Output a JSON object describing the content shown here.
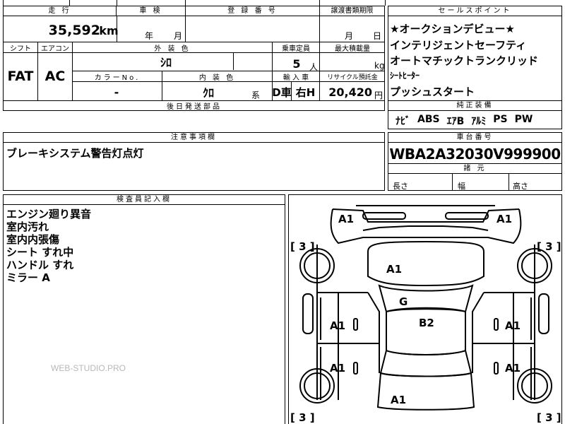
{
  "top_row": {
    "mileage_label": "走 行",
    "mileage_value": "35,592",
    "mileage_unit": "km",
    "inspection_label": "車 検",
    "inspection_year_unit": "年",
    "inspection_month_unit": "月",
    "registration_label": "登 録 番 号",
    "transfer_deadline_label": "譲渡書類期限",
    "transfer_month_unit": "月",
    "transfer_day_unit": "日"
  },
  "second_row": {
    "shift_label": "シフト",
    "shift_value": "FAT",
    "aircon_label": "エアコン",
    "aircon_value": "AC",
    "exterior_color_label": "外 装 色",
    "exterior_color_value": "ｼﾛ",
    "capacity_label": "乗車定員",
    "capacity_value": "5",
    "capacity_unit": "人",
    "max_load_label": "最大積載量",
    "max_load_unit": "kg",
    "color_no_label": "カラーNo.",
    "color_no_value": "-",
    "interior_color_label": "内 装 色",
    "interior_color_value": "ｸﾛ",
    "interior_suffix": "系",
    "import_label": "輸 入 車",
    "import_value_d": "D車",
    "import_value_h": "右H",
    "recycle_label": "リサイクル預託金",
    "recycle_value": "20,420",
    "recycle_unit": "円",
    "later_parts_label": "後日発送部品"
  },
  "sales_points": {
    "header": "セールスポイント",
    "items": [
      "★オークションデビュー★",
      "インテリジェントセーフティ",
      "オートマチックトランクリッド",
      "ｼｰﾄﾋｰﾀｰ",
      "プッシュスタート"
    ]
  },
  "standard_equipment": {
    "header": "純正装備",
    "items": [
      "ﾅﾋﾞ",
      "ABS",
      "ｴｱB",
      "ｱﾙﾐ",
      "PS",
      "PW"
    ]
  },
  "notes": {
    "header": "注意事項欄",
    "text": "ブレーキシステム警告灯点灯"
  },
  "chassis": {
    "header": "車台番号",
    "value": "WBA2A32030V999900"
  },
  "dimensions": {
    "header": "諸 元",
    "length_label": "長さ",
    "width_label": "幅",
    "height_label": "高さ"
  },
  "inspector": {
    "header": "検査員記入欄",
    "lines": [
      "エンジン廻り異音",
      "室内汚れ",
      "室内内張傷",
      "シート すれ中",
      "ハンドル すれ",
      "ミラー A"
    ]
  },
  "diagram": {
    "marks": {
      "front_left": "A1",
      "front_right": "A1",
      "hood": "A1",
      "roof_front": "G",
      "roof": "B2",
      "left_front_door": "A1",
      "right_front_door": "A1",
      "left_rear_door": "A1",
      "right_rear_door": "A1",
      "trunk": "A1"
    },
    "tire_marks": {
      "front_left": "[ 3 ]",
      "front_right": "[ 3 ]",
      "rear_left": "[ 3 ]",
      "rear_right": "[ 3 ]"
    }
  },
  "watermark": "WEB-STUDIO.PRO"
}
